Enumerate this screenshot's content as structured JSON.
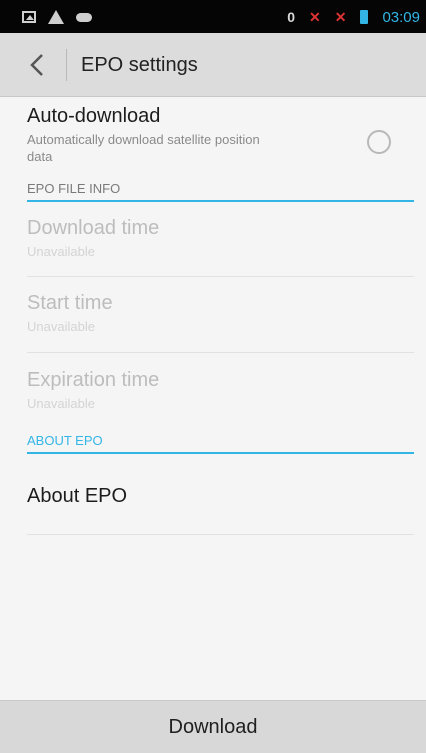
{
  "status_bar": {
    "icons_left": [
      "image-icon",
      "warning-icon",
      "cloud-icon"
    ],
    "notification_count": "0",
    "time": "03:09",
    "colors": {
      "time": "#33b5e5",
      "signal_error": "#dd3333"
    }
  },
  "action_bar": {
    "title": "EPO settings"
  },
  "auto_download": {
    "title": "Auto-download",
    "summary": "Automatically download satellite position data",
    "checked": false
  },
  "sections": {
    "epo_file_info": "EPO FILE INFO",
    "about_epo": "ABOUT EPO"
  },
  "file_info": [
    {
      "title": "Download time",
      "value": "Unavailable"
    },
    {
      "title": "Start time",
      "value": "Unavailable"
    },
    {
      "title": "Expiration time",
      "value": "Unavailable"
    }
  ],
  "about": {
    "title": "About EPO"
  },
  "bottom": {
    "download_label": "Download"
  },
  "colors": {
    "accent": "#33b5e5",
    "background": "#f5f5f5",
    "action_bar": "#dcdcdc",
    "disabled_text": "#bdbdbd"
  }
}
